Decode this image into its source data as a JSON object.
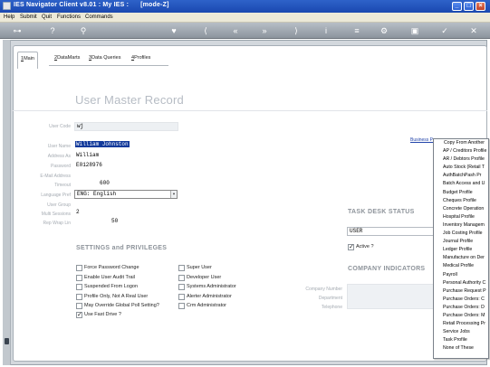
{
  "window": {
    "title": "IES Navigator Client v8.01 : My IES :      [mode-Z]",
    "controls": [
      "_",
      "□",
      "×"
    ]
  },
  "menubar": [
    "Help",
    "Submit",
    "Quit",
    "Functions",
    "Commands"
  ],
  "toolbar": {
    "icons": [
      "key-icon",
      "help-icon",
      "search-icon",
      "heart-icon",
      "first-icon",
      "prev-icon",
      "next-icon",
      "last-icon",
      "info-icon",
      "list-icon",
      "config-icon",
      "save-icon",
      "tick-icon",
      "close-icon"
    ]
  },
  "tabs": [
    {
      "key": "1",
      "label": "Main",
      "active": true
    },
    {
      "key": "2",
      "label": "DataMarts"
    },
    {
      "key": "3",
      "label": "Data Queries"
    },
    {
      "key": "4",
      "label": "Profiles"
    }
  ],
  "page_title": "User Master Record",
  "fields": {
    "user_code": {
      "label": "User Code",
      "value": "wj"
    },
    "user_name": {
      "label": "User Name",
      "value": "William Johnston"
    },
    "address_as": {
      "label": "Address As",
      "value": "William"
    },
    "password": {
      "label": "Password",
      "value": "E0128976"
    },
    "email": {
      "label": "E-Mail Address",
      "value": ""
    },
    "timeout": {
      "label": "Timeout",
      "value": "600"
    },
    "language": {
      "label": "Language Pref",
      "value": "ENG: English"
    },
    "user_group": {
      "label": "User Group",
      "value": ""
    },
    "multi_sessions": {
      "label": "Multi Sessions",
      "value": "2"
    },
    "rep_wrap": {
      "label": "Rep Wrap Lin",
      "value": "50"
    }
  },
  "settings": {
    "title": "SETTINGS and PRIVILEGES",
    "left": [
      {
        "label": "Force Password Change",
        "checked": false
      },
      {
        "label": "Enable User Audit Trail",
        "checked": false
      },
      {
        "label": "Suspended From Logon",
        "checked": false
      },
      {
        "label": "Profile Only, Not A Real User",
        "checked": false
      },
      {
        "label": "May Override Global Poll Setting?",
        "checked": false
      },
      {
        "label": "Use Fast Drive ?",
        "checked": true
      }
    ],
    "right": [
      {
        "label": "Super User",
        "checked": false
      },
      {
        "label": "Developer User",
        "checked": false
      },
      {
        "label": "Systems Administrator",
        "checked": false
      },
      {
        "label": "Alerter Administrator",
        "checked": false
      },
      {
        "label": "Crm Administrator",
        "checked": false
      }
    ]
  },
  "task_desk": {
    "title": "TASK DESK STATUS",
    "value": "USER",
    "active_label": "Active ?",
    "active": true
  },
  "company": {
    "title": "COMPANY INDICATORS",
    "labels": [
      "Company Number",
      "Department",
      "Telephone"
    ]
  },
  "business_link": "Business Pr",
  "dropdown": {
    "items": [
      "Copy From Another",
      "AP / Creditors Profile",
      "AR / Debtors Profile",
      "Auto Stock (Retail T",
      "AuthBatchPash Pr",
      "Batch Access and U",
      "Budget Profile",
      "Cheques Profile",
      "Concrete Operation",
      "Hospital Profile",
      "Inventory Managem",
      "Job Costing Profile",
      "Journal Profile",
      "Ledger Profile",
      "Manufacture on Der",
      "Medical Profile",
      "Payroll",
      "Personal Authority C",
      "Purchase Request P",
      "Purchase Orders: C",
      "Purchase Orders: D",
      "Purchase Orders: M",
      "Retail Processing Pr",
      "Service Jobs",
      "Task Profile",
      "None of These"
    ]
  }
}
